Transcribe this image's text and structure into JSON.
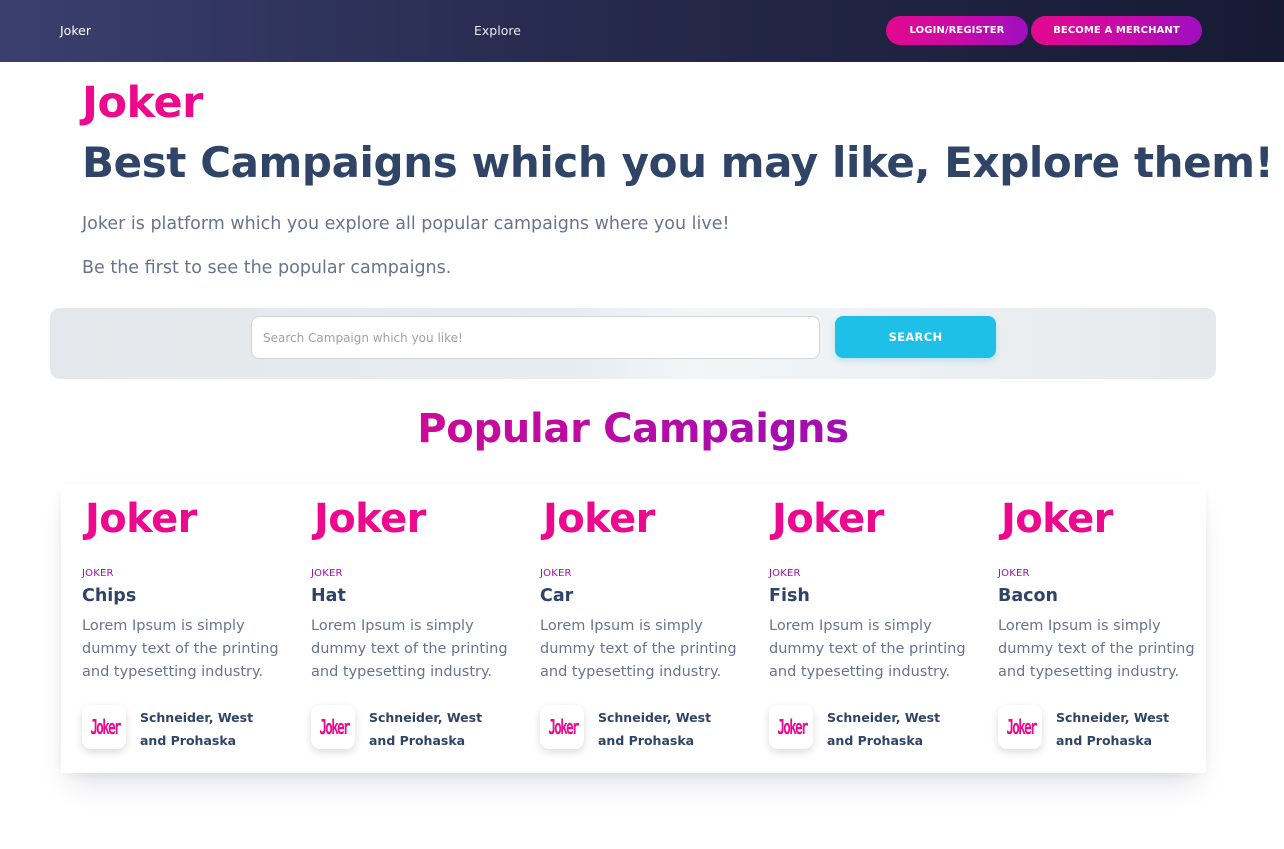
{
  "navbar": {
    "brand": "Joker",
    "explore": "Explore",
    "login_label": "LOGIN/REGISTER",
    "merchant_label": "BECOME A MERCHANT"
  },
  "hero": {
    "brand": "Joker",
    "title": "Best Campaigns which you may like, Explore them!",
    "subtitle_1": "Joker is platform which you explore all popular campaigns where you live!",
    "subtitle_2": "Be the first to see the popular campaigns."
  },
  "search": {
    "placeholder": "Search Campaign which you like!",
    "value": "",
    "button_label": "SEARCH"
  },
  "section": {
    "title": "Popular Campaigns"
  },
  "campaigns": [
    {
      "logo": "Joker",
      "tag": "JOKER",
      "title": "Chips",
      "description": "Lorem Ipsum is simply dummy text of the printing and typesetting industry.",
      "avatar_text": "Joker",
      "author": "Schneider, West and Prohaska"
    },
    {
      "logo": "Joker",
      "tag": "JOKER",
      "title": "Hat",
      "description": "Lorem Ipsum is simply dummy text of the printing and typesetting industry.",
      "avatar_text": "Joker",
      "author": "Schneider, West and Prohaska"
    },
    {
      "logo": "Joker",
      "tag": "JOKER",
      "title": "Car",
      "description": "Lorem Ipsum is simply dummy text of the printing and typesetting industry.",
      "avatar_text": "Joker",
      "author": "Schneider, West and Prohaska"
    },
    {
      "logo": "Joker",
      "tag": "JOKER",
      "title": "Fish",
      "description": "Lorem Ipsum is simply dummy text of the printing and typesetting industry.",
      "avatar_text": "Joker",
      "author": "Schneider, West and Prohaska"
    },
    {
      "logo": "Joker",
      "tag": "JOKER",
      "title": "Bacon",
      "description": "Lorem Ipsum is simply dummy text of the printing and typesetting industry.",
      "avatar_text": "Joker",
      "author": "Schneider, West and Prohaska"
    }
  ],
  "colors": {
    "brand_pink": "#ec098d",
    "accent_purple": "#a10cb0",
    "heading": "#2f4467",
    "body_text": "#67748e",
    "search_button": "#1ec0e8",
    "navbar_dark": "#262a4d"
  }
}
